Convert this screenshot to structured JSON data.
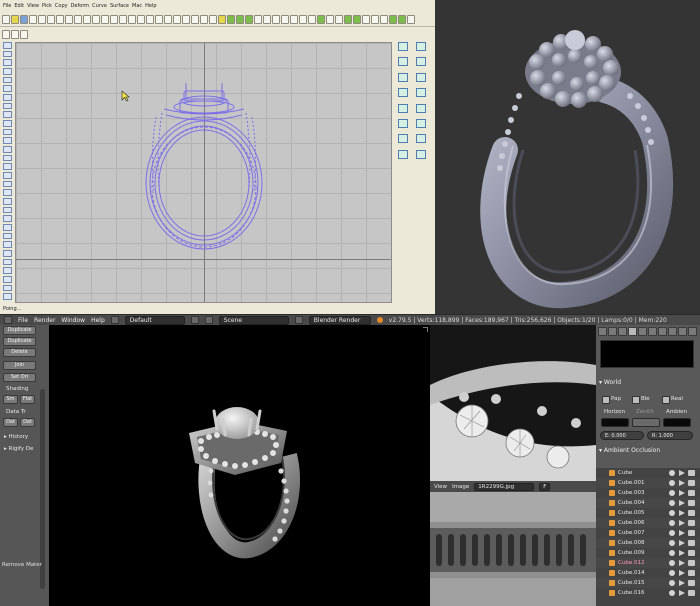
{
  "cad": {
    "menu": [
      "File",
      "Edit",
      "View",
      "Pick",
      "Copy",
      "Deform",
      "Curve",
      "Surface",
      "Mac",
      "Help"
    ],
    "status_text": "Poing..."
  },
  "blender_header": {
    "menus": [
      "File",
      "Render",
      "Window",
      "Help"
    ],
    "layout": "Default",
    "scene": "Scene",
    "engine": "Blender Render",
    "stats": "v2.79.5 | Verts:118,899 | Faces:189,967 | Tris:256,626 | Objects:1/20 | Lamps:0/0 | Mem:220"
  },
  "tool_shelf": {
    "buttons": [
      "Duplicate",
      "Duplicate",
      "Delete",
      "Join",
      "Set Ori"
    ],
    "shading_label": "Shading",
    "shading_buttons": [
      "Sm",
      "Flat"
    ],
    "data_label": "Data Tr",
    "data_buttons": [
      "Dat",
      "Dat"
    ],
    "sections": [
      "History",
      "Rigify De"
    ],
    "footer": "Remove Mater"
  },
  "image_editor": {
    "menus": [
      "View",
      "Image"
    ],
    "image_name": "1R2299G.jpg",
    "flag": "F"
  },
  "properties": {
    "world_title": "World",
    "checkboxes": [
      "Pap",
      "Ble",
      "Real"
    ],
    "columns": [
      "Horizon",
      "Zenith",
      "Ambien"
    ],
    "colors": {
      "horizon": "#0a0a0a",
      "zenith": "#6a6a6a",
      "ambient": "#0a0a0a"
    },
    "exposure": "E: 0.000",
    "range": "R: 1.000",
    "ao_title": "Ambient Occlusion"
  },
  "outliner": {
    "items": [
      "Cube",
      "Cube.001",
      "Cube.003",
      "Cube.004",
      "Cube.005",
      "Cube.006",
      "Cube.007",
      "Cube.008",
      "Cube.009",
      "Cube.012",
      "Cube.014",
      "Cube.015",
      "Cube.016"
    ],
    "selected": "Cube.012"
  }
}
